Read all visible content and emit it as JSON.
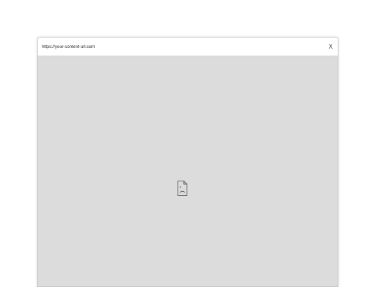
{
  "popup": {
    "url": "https://your-content-url.com",
    "close_label": "X"
  },
  "content": {
    "state_icon": "broken-page-icon"
  },
  "colors": {
    "header_bg": "#ffffff",
    "body_bg": "#dcdcdc",
    "border": "#c8c8c8",
    "icon": "#5f6368"
  }
}
